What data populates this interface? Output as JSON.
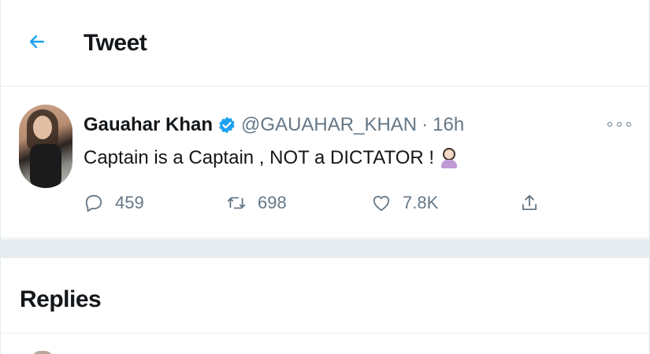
{
  "header": {
    "title": "Tweet"
  },
  "tweet": {
    "display_name": "Gauahar Khan",
    "handle": "@GAUAHAR_KHAN",
    "separator": "·",
    "time": "16h",
    "text": "Captain is a Captain , NOT a DICTATOR !",
    "stats": {
      "replies": "459",
      "retweets": "698",
      "likes": "7.8K"
    }
  },
  "replies": {
    "title": "Replies"
  },
  "icons": {
    "back": "arrow-left-icon",
    "verified": "verified-badge-icon",
    "more": "more-icon",
    "reply": "reply-icon",
    "retweet": "retweet-icon",
    "like": "heart-icon",
    "share": "share-icon"
  },
  "colors": {
    "accent": "#1da1f2",
    "text": "#14171a",
    "muted": "#657786",
    "border": "#e6ecf0"
  }
}
